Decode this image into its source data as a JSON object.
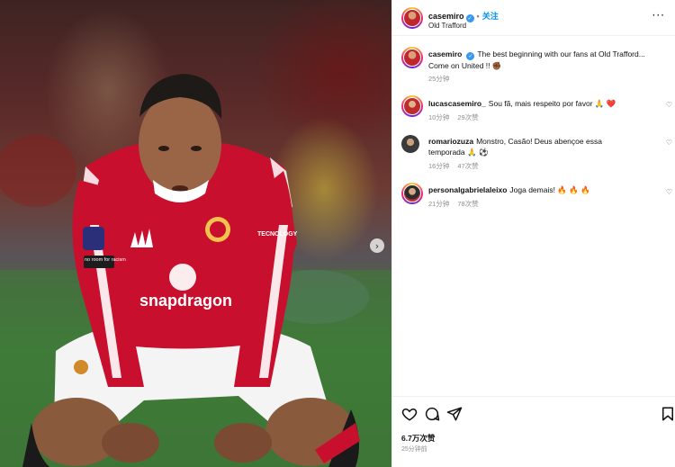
{
  "post": {
    "username": "casemiro",
    "follow_label": "关注",
    "location": "Old Trafford",
    "more_icon": "more-horizontal-icon"
  },
  "caption": {
    "username": "casemiro",
    "text": "The best beginning with our fans at Old Trafford... Come on United !! ✊🏾",
    "time": "25分钟"
  },
  "comments": [
    {
      "username": "lucascasemiro_",
      "text": "Sou fã, mais respeito por favor 🙏 ❤️",
      "time": "10分钟",
      "likes": "29次赞",
      "reply": ""
    },
    {
      "username": "romariozuza",
      "text": "Monstro, Casão! Deus abençoe essa temporada 🙏 ⚽",
      "time": "16分钟",
      "likes": "47次赞",
      "reply": ""
    },
    {
      "username": "personalgabrielaleixo",
      "text": "Joga demais! 🔥 🔥 🔥",
      "time": "21分钟",
      "likes": "78次赞",
      "reply": ""
    }
  ],
  "actions": {
    "like_count": "6.7万次赞",
    "posted_time": "25分钟前"
  },
  "photo": {
    "sponsor_text": "snapdragon",
    "sleeve_badge": "no room for racism",
    "sponsor_sleeve": "TECNOLOGY"
  },
  "colors": {
    "accent": "#0095f6",
    "verified": "#3897f0",
    "kit_red": "#c8102e"
  }
}
